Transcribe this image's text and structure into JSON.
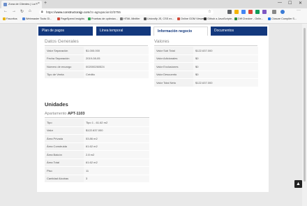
{
  "browser": {
    "tab_title": "Zona de Clientes | La P. Construcci",
    "tab_close": "×",
    "new_tab": "+",
    "window_minimize": "—",
    "window_maximize": "☐",
    "window_close": "✕",
    "url_scheme": "https://",
    "url_host": "www.constructorajp.com",
    "url_path": "/zc-agrupacion/2/3755",
    "bookmarks": [
      {
        "label": "Favoritos",
        "color": "#e8b100"
      },
      {
        "label": "Webmaster Tools Gl...",
        "color": "#4a7fd6"
      },
      {
        "label": "PageSpeed Insights",
        "color": "#d14836"
      },
      {
        "label": "Pruebas de optimiza...",
        "color": "#34a853"
      },
      {
        "label": "HTML Minifier",
        "color": "#777777"
      },
      {
        "label": "Unicrolfy JS, CSS ex...",
        "color": "#555555"
      },
      {
        "label": "Online GOM Viewer",
        "color": "#d14836"
      },
      {
        "label": "Github a JavaScripte...",
        "color": "#333333"
      },
      {
        "label": "Diff Checker - Onlin...",
        "color": "#2b8a3e"
      },
      {
        "label": "Closure Compiler S...",
        "color": "#1a73e8"
      }
    ]
  },
  "tabs": [
    {
      "label": "Plan de pagos",
      "active": false
    },
    {
      "label": "Línea temporal",
      "active": false
    },
    {
      "label": "Información negocio",
      "active": true
    },
    {
      "label": "Documentos",
      "active": false
    }
  ],
  "datos_generales": {
    "title": "Datos Generales",
    "rows": [
      {
        "label": "Valor Separación",
        "value": "$1.000.000"
      },
      {
        "label": "Fecha Separación",
        "value": "2019-08-05"
      },
      {
        "label": "Número de encargo",
        "value": "002000260524"
      },
      {
        "label": "Tipo de Venta",
        "value": "Crédito"
      }
    ]
  },
  "valores": {
    "title": "Valores",
    "rows": [
      {
        "label": "Valor Sub Total",
        "value": "$122.637.000"
      },
      {
        "label": "Valor Adicionales",
        "value": "$0"
      },
      {
        "label": "Valor Exclusiones",
        "value": "$0"
      },
      {
        "label": "Valor Descuento",
        "value": "$0"
      },
      {
        "label": "Valor Total Neto",
        "value": "$122.637.000"
      }
    ]
  },
  "unidades": {
    "title": "Unidades",
    "apt_prefix": "Apartamento",
    "apt_code": "APT-1103",
    "rows": [
      {
        "label": "Tipo",
        "value": "Tipo 1 - 61.62 m2"
      },
      {
        "label": "Valor",
        "value": "$122.637.000"
      },
      {
        "label": "Área Privada",
        "value": "53.86 m2"
      },
      {
        "label": "Área Construida",
        "value": "61.62 m2"
      },
      {
        "label": "Área Balcón",
        "value": "2.8 m2"
      },
      {
        "label": "Área Total",
        "value": "61.62 m2"
      },
      {
        "label": "Piso",
        "value": "11"
      },
      {
        "label": "Cantidad Alcobas",
        "value": "3"
      }
    ]
  },
  "scroll_top_icon": "▲"
}
